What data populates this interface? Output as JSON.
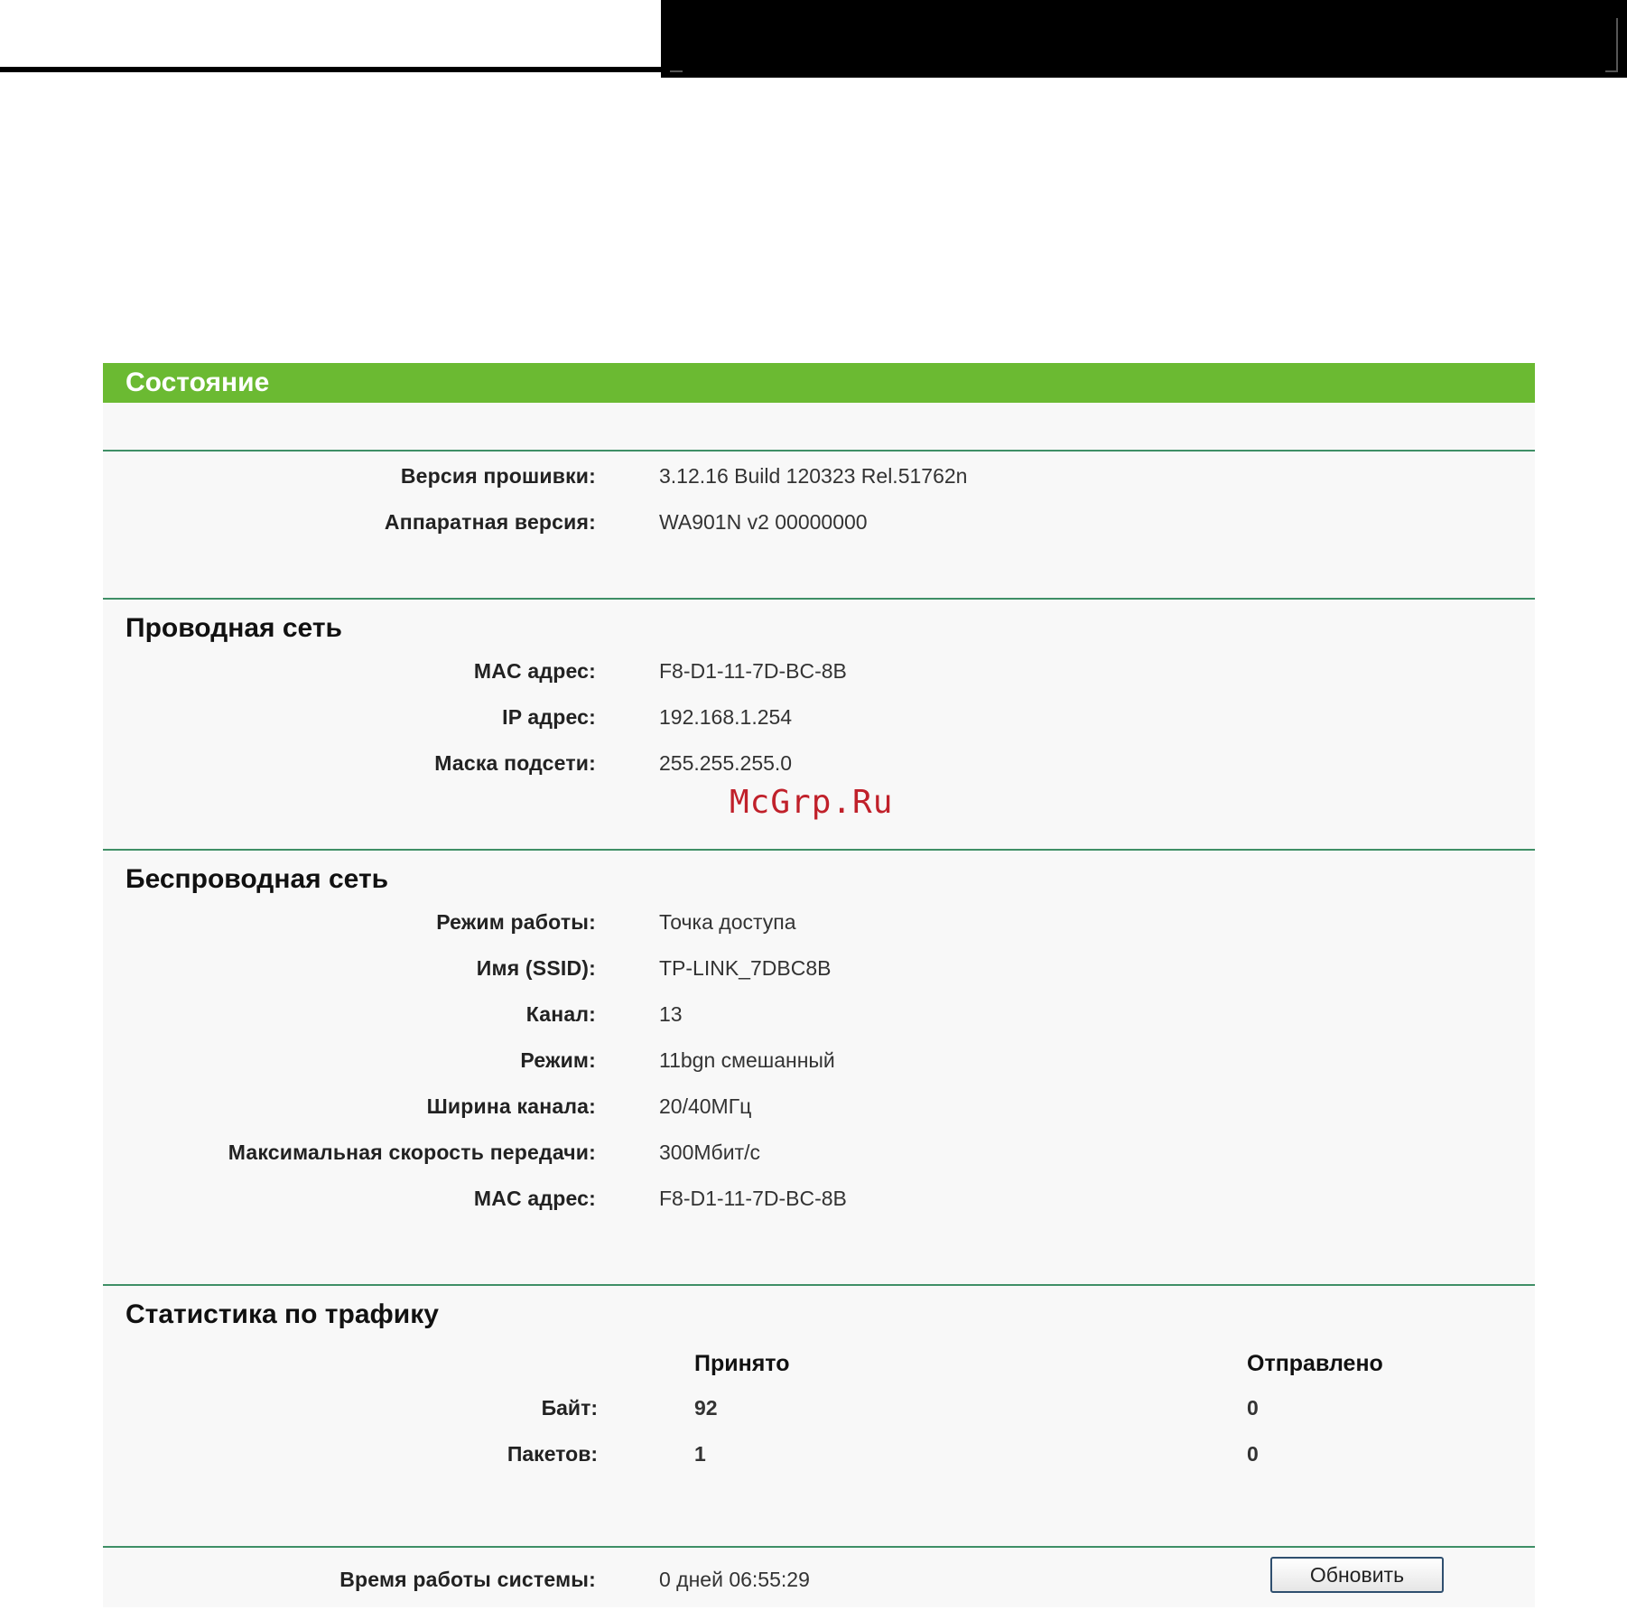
{
  "status": {
    "title": "Состояние"
  },
  "firmware": {
    "firmware_label": "Версия прошивки:",
    "firmware_value": "3.12.16 Build 120323 Rel.51762n",
    "hardware_label": "Аппаратная версия:",
    "hardware_value": "WA901N v2 00000000"
  },
  "wired": {
    "heading": "Проводная сеть",
    "mac_label": "MAC адрес:",
    "mac_value": "F8-D1-11-7D-BC-8B",
    "ip_label": "IP адрес:",
    "ip_value": "192.168.1.254",
    "mask_label": "Маска подсети:",
    "mask_value": "255.255.255.0"
  },
  "wireless": {
    "heading": "Беспроводная сеть",
    "rows": [
      {
        "label": "Режим работы:",
        "value": "Точка доступа"
      },
      {
        "label": "Имя (SSID):",
        "value": "TP-LINK_7DBC8B"
      },
      {
        "label": "Канал:",
        "value": "13"
      },
      {
        "label": "Режим:",
        "value": "11bgn смешанный"
      },
      {
        "label": "Ширина канала:",
        "value": "20/40МГц"
      },
      {
        "label": "Максимальная скорость передачи:",
        "value": "300Мбит/с"
      },
      {
        "label": "MAC адрес:",
        "value": "F8-D1-11-7D-BC-8B"
      }
    ]
  },
  "traffic": {
    "heading": "Статистика по трафику",
    "col_received": "Принято",
    "col_sent": "Отправлено",
    "rows": [
      {
        "label": "Байт:",
        "received": "92",
        "sent": "0"
      },
      {
        "label": "Пакетов:",
        "received": "1",
        "sent": "0"
      }
    ]
  },
  "uptime": {
    "label": "Время работы системы:",
    "value": "0 дней 06:55:29",
    "refresh_label": "Обновить"
  },
  "watermark": "McGrp.Ru"
}
